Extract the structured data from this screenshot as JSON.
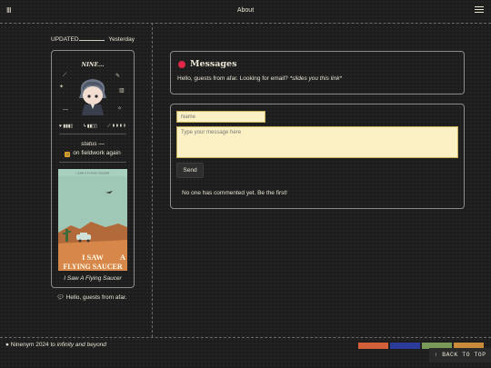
{
  "header": {
    "logo_glyph": "Ⅲ",
    "nav_about": "About",
    "menu_icon": "hamburger-icon"
  },
  "sidebar": {
    "updated_label": "UPDATED",
    "updated_time": "Yesterday",
    "profile": {
      "name": "NINE",
      "name_suffix": "...",
      "status_label": "status —",
      "status_text": "on fieldwork again",
      "book_title_top": "I SAW A FLYING SAUCER",
      "book_word_1": "I SAW",
      "book_word_a": "A",
      "book_word_2": "FLYING SAUCER",
      "book_caption": "I Saw A Flying Saucer"
    },
    "greeting": "Hello, guests from afar."
  },
  "messages": {
    "title": "Messages",
    "intro_text": "Hello, guests from afar. Looking for email? ",
    "intro_em": "*slides you this link*"
  },
  "comment_form": {
    "name_placeholder": "Name",
    "message_placeholder": "Type your message here",
    "send_label": "Send",
    "empty_text": "No one has commented yet. Be the first!"
  },
  "footer": {
    "text": "Ninenym 2024 to ",
    "text_em": "infinity and beyond",
    "back_to_top": "↑ BACK TO TOP"
  },
  "colors": {
    "accent_dot": "#e0264a",
    "input_bg": "#fcf1c4",
    "background": "#1d1d1d"
  }
}
